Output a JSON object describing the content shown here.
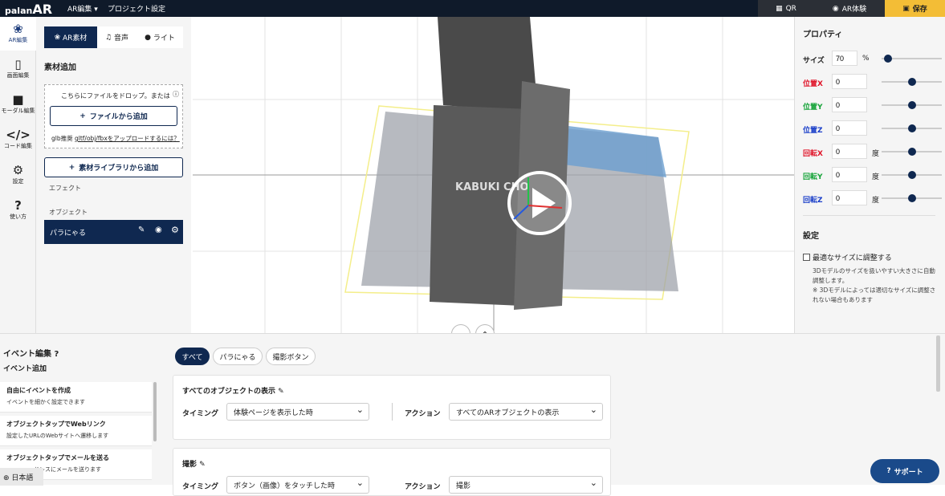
{
  "topbar": {
    "logo_prefix": "palan",
    "logo_suffix": "AR",
    "menu_ar_edit": "AR編集 ▾",
    "menu_project_settings": "プロジェクト設定",
    "qr_label": "QR",
    "ar_experience_label": "AR体験",
    "save_label": "保存"
  },
  "leftnav": {
    "items": [
      {
        "label": "AR編集",
        "icon": "shapes-icon"
      },
      {
        "label": "画面編集",
        "icon": "phone-icon"
      },
      {
        "label": "モーダル編集",
        "icon": "speech-bubble-icon"
      },
      {
        "label": "コード編集",
        "icon": "code-icon"
      },
      {
        "label": "設定",
        "icon": "gear-icon"
      },
      {
        "label": "使い方",
        "icon": "question-icon"
      }
    ]
  },
  "panel": {
    "tabs": [
      "AR素材",
      "音声",
      "ライト"
    ],
    "section_title": "素材追加",
    "drop_text": "こちらにファイルをドロップ。または",
    "add_file_button": "ファイルから追加",
    "glb_note": "glb推奨",
    "upload_link": "gltf/obj/fbxをアップロードするには？",
    "library_button": "素材ライブラリから追加",
    "effect_label": "エフェクト",
    "object_label": "オブジェクト",
    "object_item": "パラにゃる"
  },
  "viewport": {
    "building_text": "KABUKI CHO"
  },
  "props": {
    "title": "プロパティ",
    "size": {
      "label": "サイズ",
      "value": "70",
      "unit": "%",
      "level": 0.05
    },
    "rows": [
      {
        "label": "位置X",
        "value": "0",
        "unit": "",
        "color": "#e0152a",
        "level": 0.5
      },
      {
        "label": "位置Y",
        "value": "0",
        "unit": "",
        "color": "#15a338",
        "level": 0.5
      },
      {
        "label": "位置Z",
        "value": "0",
        "unit": "",
        "color": "#1b3fc9",
        "level": 0.5
      },
      {
        "label": "回転X",
        "value": "0",
        "unit": "度",
        "color": "#e0152a",
        "level": 0.5
      },
      {
        "label": "回転Y",
        "value": "0",
        "unit": "度",
        "color": "#15a338",
        "level": 0.5
      },
      {
        "label": "回転Z",
        "value": "0",
        "unit": "度",
        "color": "#1b3fc9",
        "level": 0.5
      }
    ],
    "settings_title": "設定",
    "optimize_label": "最適なサイズに調整する",
    "optimize_desc": "3Dモデルのサイズを扱いやすい大きさに自動調整します。",
    "optimize_note": "※ 3Dモデルによっては適切なサイズに調整されない場合もあります"
  },
  "events": {
    "title": "イベント編集",
    "add_title": "イベント追加",
    "items": [
      {
        "title": "自由にイベントを作成",
        "desc": "イベントを細かく設定できます"
      },
      {
        "title": "オブジェクトタップでWebリンク",
        "desc": "設定したURLのWebサイトへ遷移します"
      },
      {
        "title": "オブジェクトタップでメールを送る",
        "desc": "ドレスにメールを送ります"
      }
    ],
    "language": "日本語",
    "filters": [
      "すべて",
      "パラにゃる",
      "撮影ボタン"
    ],
    "cards": [
      {
        "title": "すべてのオブジェクトの表示",
        "timing_label": "タイミング",
        "timing_value": "体験ページを表示した時",
        "action_label": "アクション",
        "action_value": "すべてのARオブジェクトの表示"
      },
      {
        "title": "撮影",
        "timing_label": "タイミング",
        "timing_value": "ボタン（画像）をタッチした時",
        "action_label": "アクション",
        "action_value": "撮影"
      }
    ],
    "support_label": "サポート"
  }
}
